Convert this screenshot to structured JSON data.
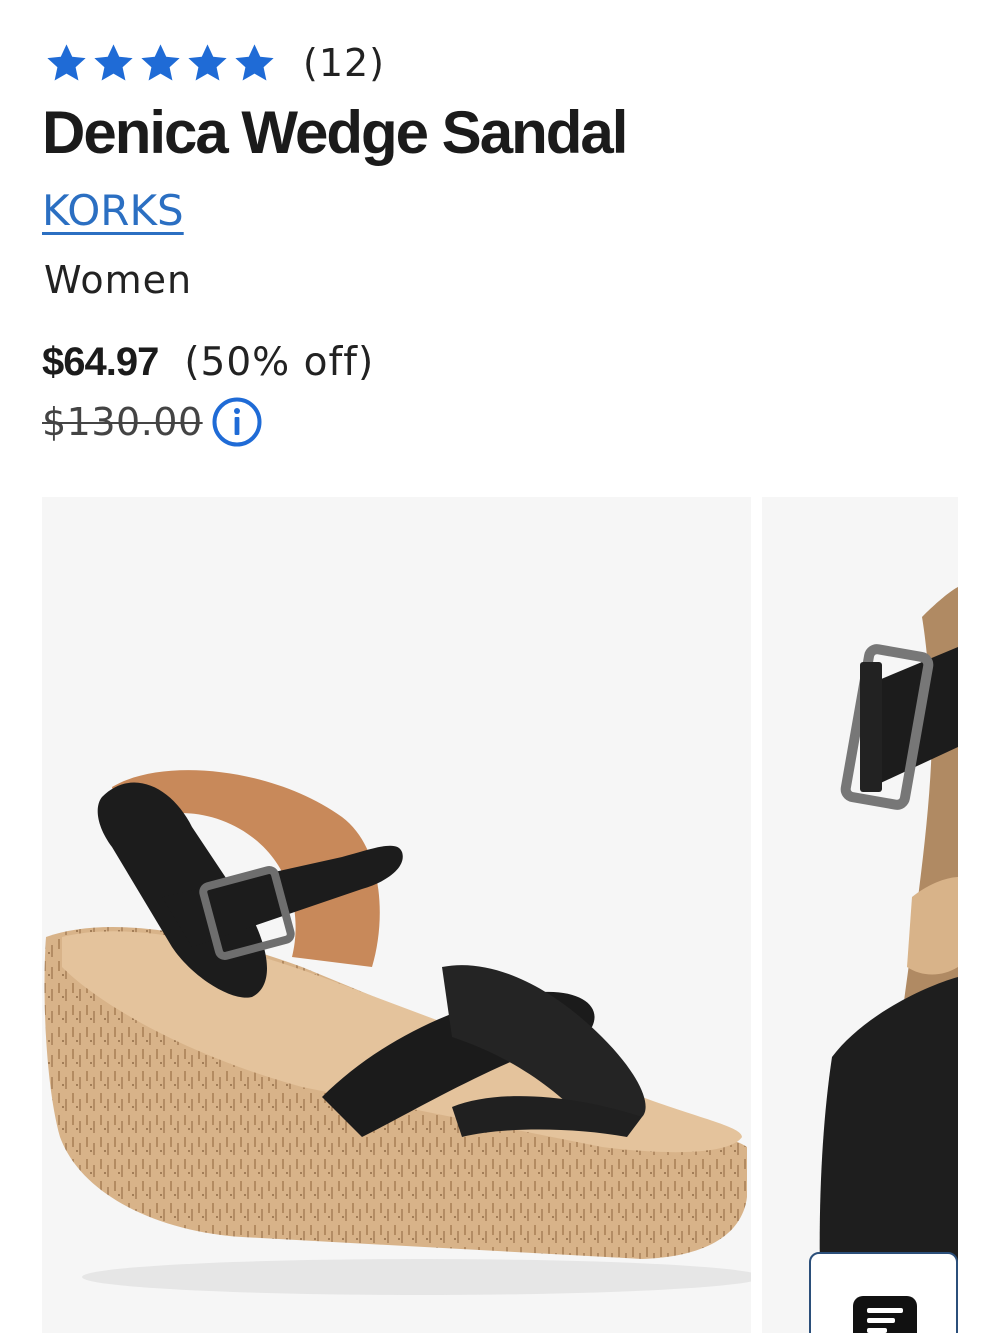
{
  "rating": {
    "stars": 5,
    "max_stars": 5,
    "star_color": "#1f6bd6",
    "review_count": "(12)"
  },
  "product": {
    "title": "Denica Wedge Sandal",
    "brand": "KORKS",
    "gender": "Women"
  },
  "price": {
    "sale": "$64.97",
    "discount": "(50% off)",
    "original": "$130.00"
  },
  "icons": {
    "star": "star-icon",
    "info": "info-icon",
    "chat": "chat-icon"
  },
  "colors": {
    "link": "#2b6fc2",
    "accent": "#1f6bd6",
    "image_bg": "#f6f6f6",
    "strap": "#1c1c1c",
    "cork": "#d9b48a",
    "leather_lining": "#c98a5a"
  },
  "gallery": {
    "images": [
      {
        "alt": "product-image-main"
      },
      {
        "alt": "product-image-detail"
      }
    ]
  }
}
